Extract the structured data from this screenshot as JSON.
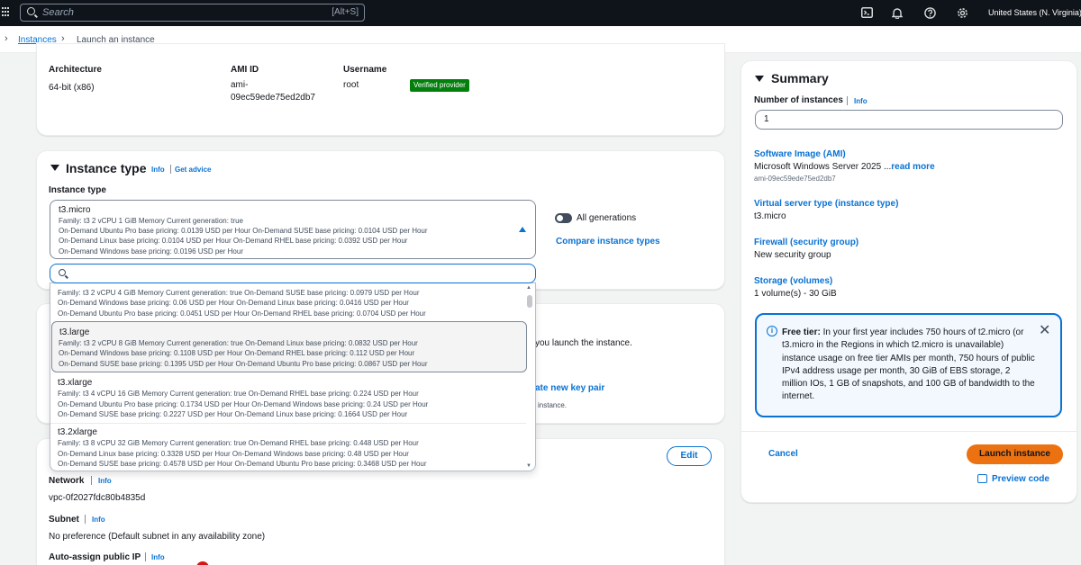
{
  "topbar": {
    "search_placeholder": "Search",
    "search_shortcut": "[Alt+S]",
    "region": "United States (N. Virginia)",
    "icons": [
      "apps-grid-icon",
      "search-icon",
      "cloudshell-icon",
      "bell-icon",
      "help-icon",
      "gear-icon"
    ]
  },
  "breadcrumb": {
    "link": "Instances",
    "current": "Launch an instance"
  },
  "ami_details": {
    "architecture_label": "Architecture",
    "architecture_value": "64-bit (x86)",
    "ami_id_label": "AMI ID",
    "ami_id_line1": "ami-",
    "ami_id_line2": "09ec59ede75ed2db7",
    "username_label": "Username",
    "username_value": "root",
    "verified_badge": "Verified provider"
  },
  "instance_type": {
    "title": "Instance type",
    "info": "Info",
    "advice": "Get advice",
    "field_label": "Instance type",
    "selected": {
      "name": "t3.micro",
      "line1": "Family: t3     2 vCPU     1 GiB Memory     Current generation: true",
      "line2": "On-Demand Ubuntu Pro base pricing: 0.0139 USD per Hour     On-Demand SUSE base pricing: 0.0104 USD per Hour",
      "line3": "On-Demand Linux base pricing: 0.0104 USD per Hour     On-Demand RHEL base pricing: 0.0392 USD per Hour",
      "line4": "On-Demand Windows base pricing: 0.0196 USD per Hour"
    },
    "all_generations": "All generations",
    "compare": "Compare instance types",
    "options": [
      {
        "name": "",
        "line1": "Family: t3     2 vCPU     4 GiB Memory     Current generation: true          On-Demand SUSE base pricing: 0.0979 USD per Hour",
        "line2": "On-Demand Windows base pricing: 0.06 USD per Hour     On-Demand Linux base pricing: 0.0416 USD per Hour",
        "line3": "On-Demand Ubuntu Pro base pricing: 0.0451 USD per Hour     On-Demand RHEL base pricing: 0.0704 USD per Hour"
      },
      {
        "name": "t3.large",
        "line1": "Family: t3     2 vCPU     8 GiB Memory     Current generation: true          On-Demand Linux base pricing: 0.0832 USD per Hour",
        "line2": "On-Demand Windows base pricing: 0.1108 USD per Hour     On-Demand RHEL base pricing: 0.112 USD per Hour",
        "line3": "On-Demand SUSE base pricing: 0.1395 USD per Hour     On-Demand Ubuntu Pro base pricing: 0.0867 USD per Hour"
      },
      {
        "name": "t3.xlarge",
        "line1": "Family: t3     4 vCPU     16 GiB Memory     Current generation: true          On-Demand RHEL base pricing: 0.224 USD per Hour",
        "line2": "On-Demand Ubuntu Pro base pricing: 0.1734 USD per Hour     On-Demand Windows base pricing: 0.24 USD per Hour",
        "line3": "On-Demand SUSE base pricing: 0.2227 USD per Hour     On-Demand Linux base pricing: 0.1664 USD per Hour"
      },
      {
        "name": "t3.2xlarge",
        "line1": "Family: t3     8 vCPU     32 GiB Memory     Current generation: true          On-Demand RHEL base pricing: 0.448 USD per Hour",
        "line2": "On-Demand Linux base pricing: 0.3328 USD per Hour     On-Demand Windows base pricing: 0.48 USD per Hour",
        "line3": "On-Demand SUSE base pricing: 0.4578 USD per Hour     On-Demand Ubuntu Pro base pricing: 0.3468 USD per Hour"
      }
    ]
  },
  "key_pair_partial": {
    "text1": "you launch the instance.",
    "link": "ate new key pair",
    "text2": "instance."
  },
  "network": {
    "edit": "Edit",
    "network_label": "Network",
    "network_info": "Info",
    "network_value": "vpc-0f2027fdc80b4835d",
    "subnet_label": "Subnet",
    "subnet_info": "Info",
    "subnet_value": "No preference (Default subnet in any availability zone)",
    "public_ip_label": "Auto-assign public IP",
    "public_ip_info": "Info"
  },
  "summary": {
    "title": "Summary",
    "instances_label": "Number of instances",
    "instances_info": "Info",
    "instances_value": "1",
    "ami_link": "Software Image (AMI)",
    "ami_value": "Microsoft Windows Server 2025 ...",
    "ami_readmore": "read more",
    "ami_id": "ami-09ec59ede75ed2db7",
    "type_link": "Virtual server type (instance type)",
    "type_value": "t3.micro",
    "firewall_link": "Firewall (security group)",
    "firewall_value": "New security group",
    "storage_link": "Storage (volumes)",
    "storage_value": "1 volume(s) - 30 GiB",
    "free_tier_title": "Free tier:",
    "free_tier_text": " In your first year includes 750 hours of t2.micro (or t3.micro in the Regions in which t2.micro is unavailable) instance usage on free tier AMIs per month, 750 hours of public IPv4 address usage per month, 30 GiB of EBS storage, 2 million IOs, 1 GB of snapshots, and 100 GB of bandwidth to the internet.",
    "cancel": "Cancel",
    "launch": "Launch instance",
    "preview": "Preview code"
  },
  "colors": {
    "accent": "#0972d3",
    "launch": "#ec7211",
    "badge": "#037f0c",
    "topbar": "#0f141a"
  }
}
